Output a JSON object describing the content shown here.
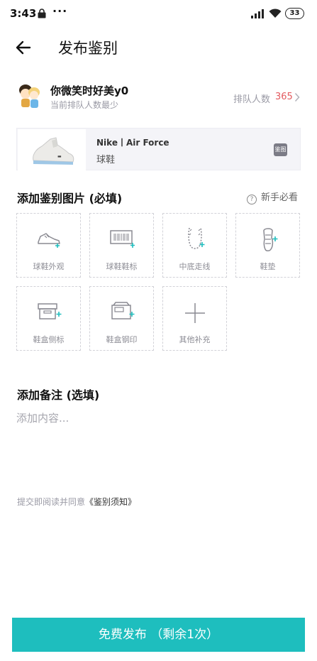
{
  "status_bar": {
    "time": "3:43",
    "dots": "···",
    "battery": "33"
  },
  "header": {
    "title": "发布鉴别"
  },
  "user": {
    "name": "你微笑时好美y0",
    "subtext": "当前排队人数最少",
    "queue_label": "排队人数",
    "queue_count": "365"
  },
  "product": {
    "brand": "Nike丨Air Force",
    "category": "球鞋",
    "tag": "鉴图"
  },
  "images_section": {
    "title": "添加鉴别图片 (必填)",
    "help_icon": "?",
    "help_label": "新手必看",
    "tiles": [
      {
        "label": "球鞋外观",
        "icon": "sneaker-icon"
      },
      {
        "label": "球鞋鞋标",
        "icon": "barcode-label-icon"
      },
      {
        "label": "中底走线",
        "icon": "midsole-stitch-icon"
      },
      {
        "label": "鞋垫",
        "icon": "insole-icon"
      },
      {
        "label": "鞋盒侧标",
        "icon": "box-side-label-icon"
      },
      {
        "label": "鞋盒钢印",
        "icon": "box-stamp-icon"
      },
      {
        "label": "其他补充",
        "icon": "plus-icon"
      }
    ]
  },
  "notes_section": {
    "title": "添加备注 (选填)",
    "placeholder": "添加内容..."
  },
  "agreement": {
    "prefix": "提交即阅读并同意",
    "link": "《鉴别须知》"
  },
  "submit": {
    "label": "免费发布 （剩余1次）"
  },
  "colors": {
    "accent": "#1ebebe",
    "queue_count": "#e35a5f",
    "icon_plus": "#1ebebe",
    "card_bg": "#f4f4f8"
  }
}
